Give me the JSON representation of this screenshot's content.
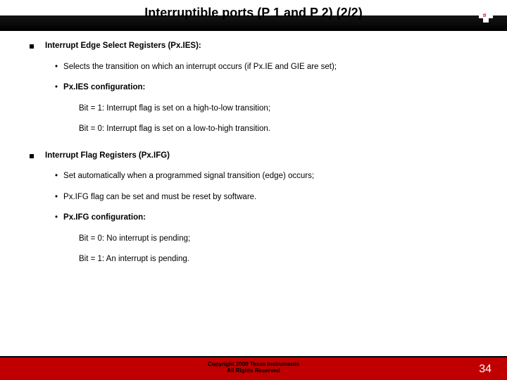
{
  "title": "Interruptible ports (P 1 and P 2)   (2/2)",
  "sections": [
    {
      "heading": "Interrupt Edge Select Registers (Px.IES):",
      "bullets": [
        {
          "text": "Selects the transition on which an interrupt occurs (if Px.IE and GIE are set);",
          "bold": false
        },
        {
          "text": "Px.IES configuration:",
          "bold": true
        }
      ],
      "sublines": [
        "Bit = 1: Interrupt flag is set on a high-to-low transition;",
        "Bit = 0: Interrupt flag is set on a low-to-high transition."
      ]
    },
    {
      "heading": "Interrupt Flag Registers (Px.IFG)",
      "bullets": [
        {
          "text": "Set automatically when a programmed signal transition (edge) occurs;",
          "bold": false
        },
        {
          "text": "Px.IFG flag can be set and must be reset by software.",
          "bold": false
        },
        {
          "text": "Px.IFG configuration:",
          "bold": true
        }
      ],
      "sublines": [
        "Bit = 0: No interrupt is pending;",
        "Bit = 1: An interrupt is pending."
      ]
    }
  ],
  "footer_line1": "Copyright  2009 Texas Instruments",
  "footer_line2": "All Rights Reserved",
  "page_number": "34"
}
